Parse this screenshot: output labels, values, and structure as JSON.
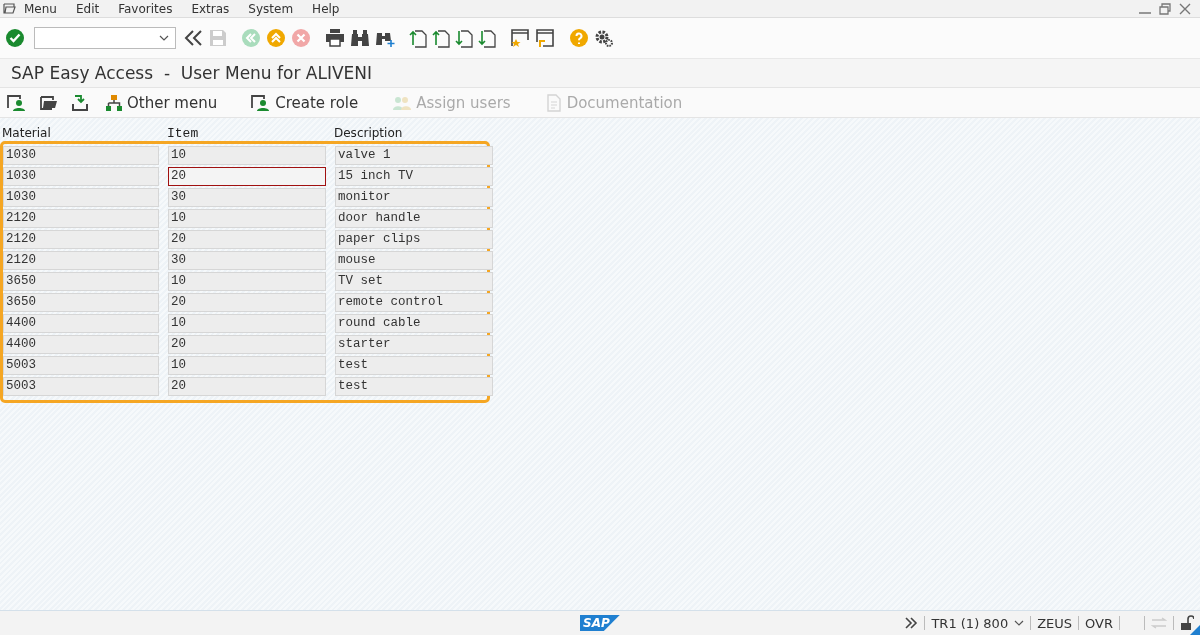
{
  "menu_bar": {
    "items": [
      "Menu",
      "Edit",
      "Favorites",
      "Extras",
      "System",
      "Help"
    ]
  },
  "title": "SAP Easy Access  -  User Menu for ALIVENI",
  "app_toolbar": [
    {
      "label": "Other menu",
      "disabled": false
    },
    {
      "label": "Create role",
      "disabled": false
    },
    {
      "label": "Assign users",
      "disabled": true
    },
    {
      "label": "Documentation",
      "disabled": true
    }
  ],
  "table": {
    "columns": [
      "Material",
      "Item",
      "Description"
    ],
    "rows": [
      {
        "material": "1030",
        "item": "10",
        "description": "valve 1",
        "focused": false
      },
      {
        "material": "1030",
        "item": "20",
        "description": "15 inch TV",
        "focused": true
      },
      {
        "material": "1030",
        "item": "30",
        "description": "monitor",
        "focused": false
      },
      {
        "material": "2120",
        "item": "10",
        "description": "door handle",
        "focused": false
      },
      {
        "material": "2120",
        "item": "20",
        "description": "paper clips",
        "focused": false
      },
      {
        "material": "2120",
        "item": "30",
        "description": "mouse",
        "focused": false
      },
      {
        "material": "3650",
        "item": "10",
        "description": "TV set",
        "focused": false
      },
      {
        "material": "3650",
        "item": "20",
        "description": "remote control",
        "focused": false
      },
      {
        "material": "4400",
        "item": "10",
        "description": "round cable",
        "focused": false
      },
      {
        "material": "4400",
        "item": "20",
        "description": "starter",
        "focused": false
      },
      {
        "material": "5003",
        "item": "10",
        "description": "test",
        "focused": false
      },
      {
        "material": "5003",
        "item": "20",
        "description": "test",
        "focused": false
      }
    ]
  },
  "status_bar": {
    "logo": "SAP",
    "system": "TR1 (1) 800",
    "server": "ZEUS",
    "mode": "OVR"
  }
}
